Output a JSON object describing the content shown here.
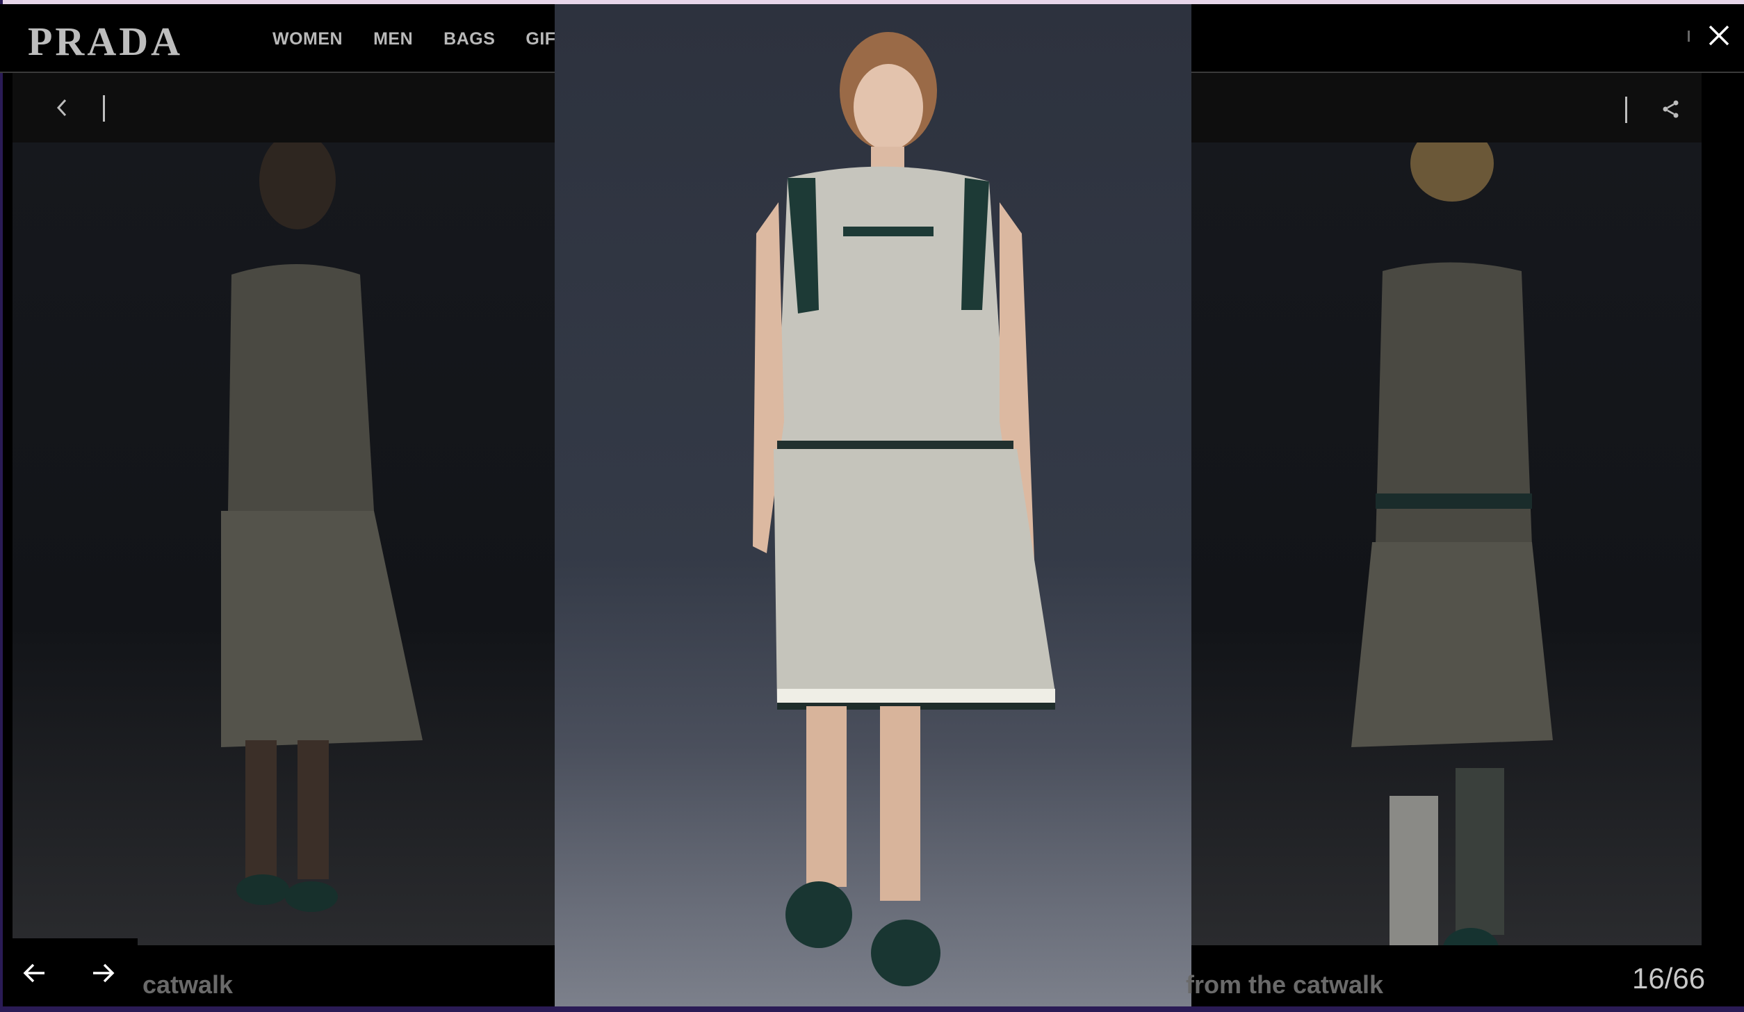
{
  "brand": {
    "logo_text": "PRADA"
  },
  "nav": {
    "items": [
      "WOMEN",
      "MEN",
      "BAGS",
      "GIFT"
    ]
  },
  "captions": {
    "left": "catwalk",
    "right": "from the catwalk"
  },
  "gallery": {
    "counter": "16/66"
  },
  "icons": {
    "close": "close-icon",
    "back": "chevron-left-icon",
    "share": "share-icon",
    "prev": "arrow-left-icon",
    "next": "arrow-right-icon"
  },
  "colors": {
    "background": "#000000",
    "text": "#bdbdbd",
    "frame": "#2a1b55"
  }
}
